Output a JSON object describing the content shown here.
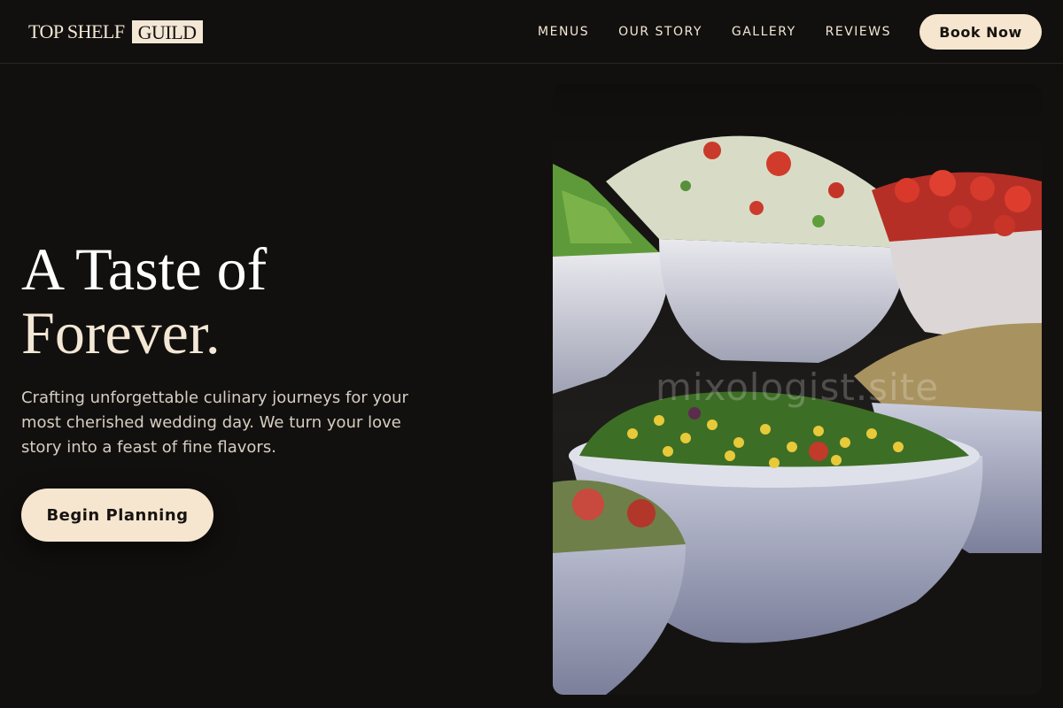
{
  "brand": {
    "part1": "TOP SHELF",
    "part2": "GUILD"
  },
  "nav": {
    "items": [
      "MENUS",
      "OUR STORY",
      "GALLERY",
      "REVIEWS"
    ],
    "cta": "Book Now"
  },
  "hero": {
    "title_line1": "A Taste of",
    "title_line2": "Forever.",
    "description": "Crafting unforgettable culinary journeys for your most cherished wedding day. We turn your love story into a feast of fine flavors.",
    "cta": "Begin Planning",
    "image_watermark": "mixologist.site"
  },
  "colors": {
    "background": "#12100e",
    "accent": "#f6e6d0",
    "text": "#f3e7d5"
  }
}
